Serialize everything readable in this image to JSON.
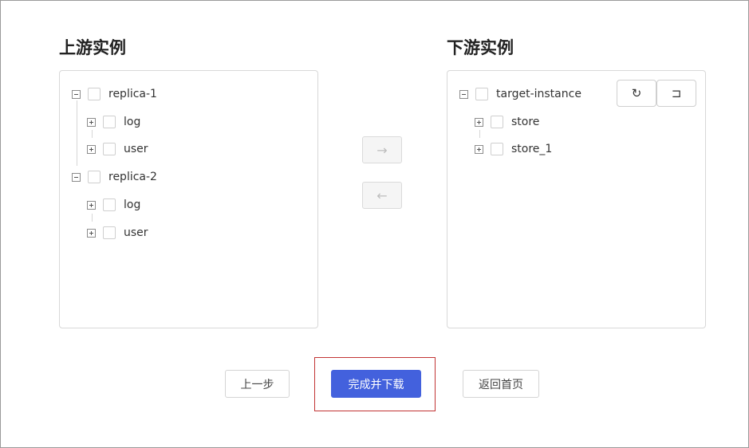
{
  "left_panel": {
    "title": "上游实例",
    "nodes": [
      {
        "label": "replica-1",
        "children": [
          {
            "label": "log"
          },
          {
            "label": "user"
          }
        ]
      },
      {
        "label": "replica-2",
        "children": [
          {
            "label": "log"
          },
          {
            "label": "user"
          }
        ]
      }
    ]
  },
  "right_panel": {
    "title": "下游实例",
    "root": {
      "label": "target-instance",
      "children": [
        {
          "label": "store"
        },
        {
          "label": "store_1"
        }
      ]
    },
    "tools": {
      "refresh_icon": "↻",
      "reset_icon": "⊐"
    }
  },
  "transfer": {
    "right_arrow": "→",
    "left_arrow": "←"
  },
  "footer": {
    "prev_label": "上一步",
    "finish_label": "完成并下载",
    "home_label": "返回首页"
  },
  "colors": {
    "primary": "#4361dd",
    "highlight": "#c23434"
  }
}
